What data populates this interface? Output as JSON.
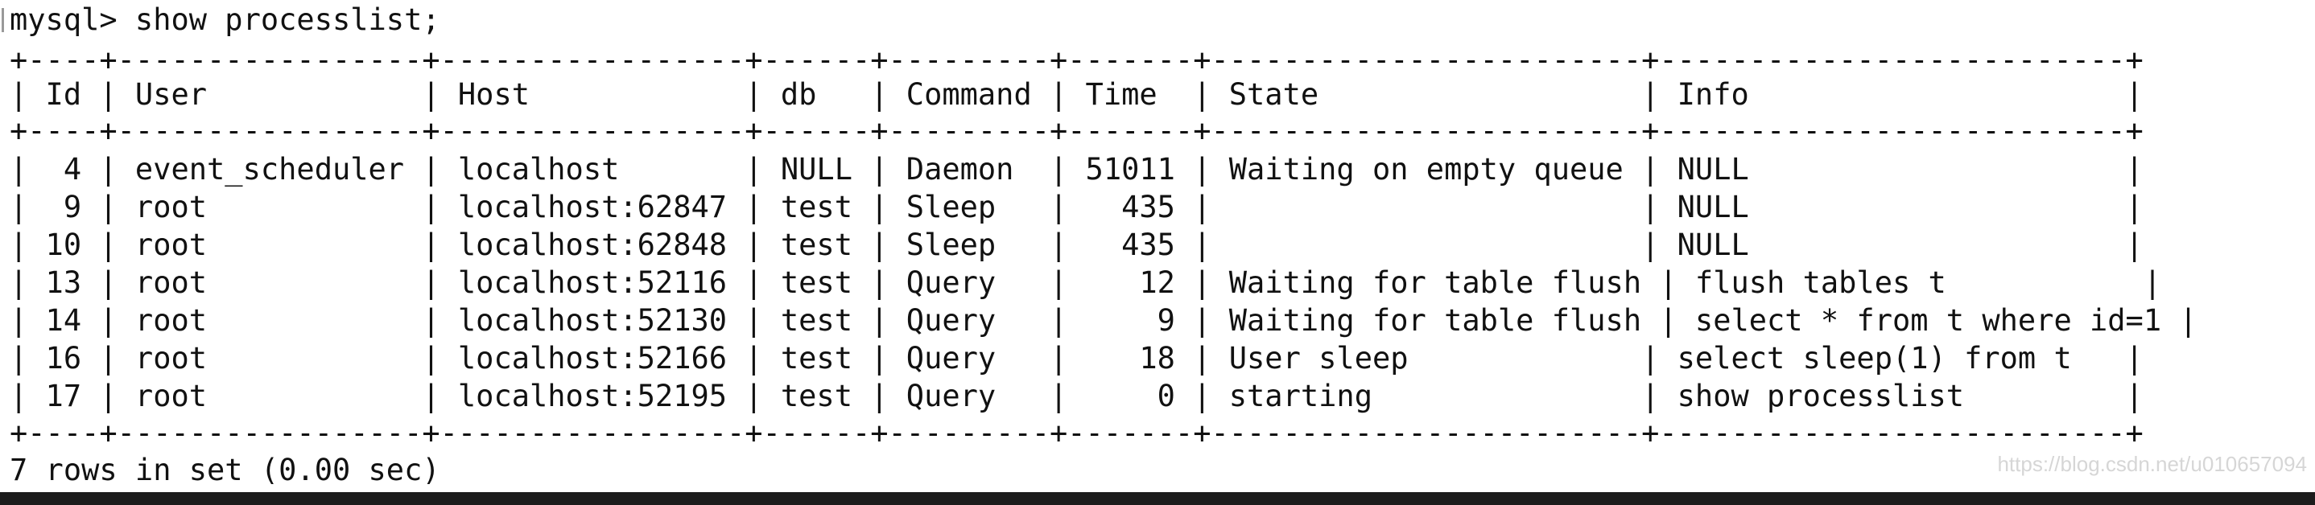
{
  "terminal": {
    "prompt": "mysql> show processlist;",
    "border": "+----+-----------------+-----------------+------+---------+-------+------------------------+--------------------------+",
    "header": "| Id | User            | Host            | db   | Command | Time  | State                  | Info                     |",
    "rows": [
      "|  4 | event_scheduler | localhost       | NULL | Daemon  | 51011 | Waiting on empty queue | NULL                     |",
      "|  9 | root            | localhost:62847 | test | Sleep   |   435 |                        | NULL                     |",
      "| 10 | root            | localhost:62848 | test | Sleep   |   435 |                        | NULL                     |",
      "| 13 | root            | localhost:52116 | test | Query   |    12 | Waiting for table flush | flush tables t           |",
      "| 14 | root            | localhost:52130 | test | Query   |     9 | Waiting for table flush | select * from t where id=1 |",
      "| 16 | root            | localhost:52166 | test | Query   |    18 | User sleep             | select sleep(1) from t   |",
      "| 17 | root            | localhost:52195 | test | Query   |     0 | starting               | show processlist         |"
    ],
    "result_summary": "7 rows in set (0.00 sec)"
  },
  "watermark": "https://blog.csdn.net/u010657094"
}
